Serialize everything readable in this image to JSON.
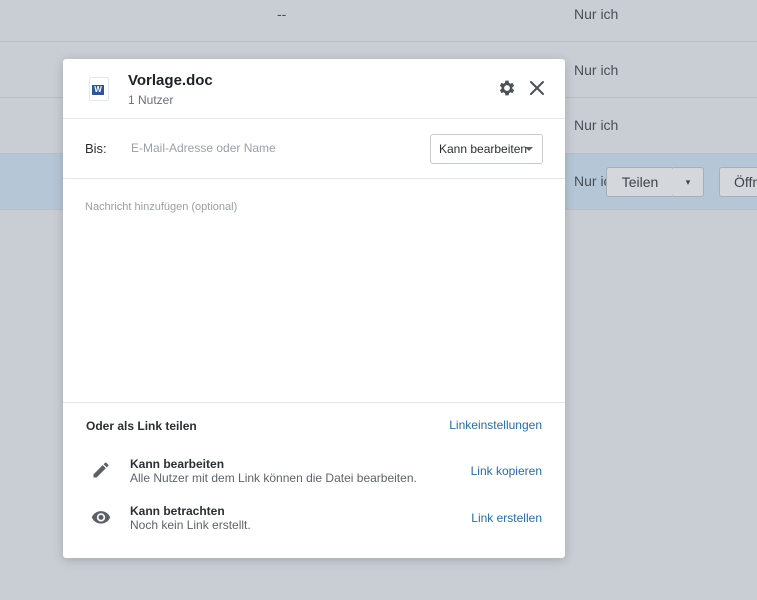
{
  "background": {
    "rows": [
      {
        "size": "--",
        "access": "Nur ich"
      },
      {
        "size": "",
        "access": "Nur ich"
      },
      {
        "size": "",
        "access": "Nur ich"
      },
      {
        "size": "",
        "access": "Nur ic"
      }
    ],
    "share_button": "Teilen",
    "open_button": "Öffn"
  },
  "dialog": {
    "file_name": "Vorlage.doc",
    "file_users": "1 Nutzer",
    "file_icon": "word-doc-icon",
    "to_label": "Bis:",
    "to_placeholder": "E-Mail-Adresse oder Name",
    "permission": "Kann bearbeiten",
    "message_placeholder": "Nachricht hinzufügen (optional)",
    "link_section_title": "Oder als Link teilen",
    "link_settings": "Linkeinstellungen",
    "options": [
      {
        "icon": "pencil-icon",
        "title": "Kann bearbeiten",
        "desc": "Alle Nutzer mit dem Link können die Datei bearbeiten.",
        "action": "Link kopieren"
      },
      {
        "icon": "eye-icon",
        "title": "Kann betrachten",
        "desc": "Noch kein Link erstellt.",
        "action": "Link erstellen"
      }
    ]
  },
  "colors": {
    "overlay": "#c9cdd4",
    "link": "#2a6aa8",
    "selected_row": "#b5c6d6"
  }
}
